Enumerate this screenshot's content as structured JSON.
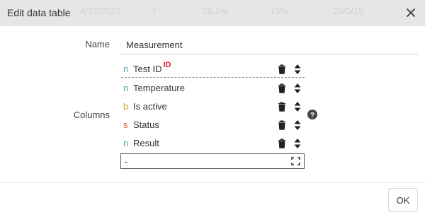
{
  "dialog": {
    "title": "Edit data table",
    "background_row": [
      "4/17/2022",
      "7",
      "16.1%",
      "15%",
      "20/0/15"
    ]
  },
  "form": {
    "name_label": "Name",
    "name_value": "Measurement",
    "columns_label": "Columns",
    "add_column_value": "-"
  },
  "columns": [
    {
      "type": "n",
      "type_color": "#5aa0a8",
      "name": "Test ID",
      "badge": "ID"
    },
    {
      "type": "n",
      "type_color": "#5aa0a8",
      "name": "Temperature"
    },
    {
      "type": "b",
      "type_color": "#c9a227",
      "name": "Is active"
    },
    {
      "type": "s",
      "type_color": "#d0622a",
      "name": "Status"
    },
    {
      "type": "n",
      "type_color": "#5aa0a8",
      "name": "Result"
    }
  ],
  "icons": {
    "close": "close-icon",
    "delete": "trash-icon",
    "sort": "sort-icon",
    "expand": "expand-icon",
    "help": "help-icon"
  },
  "footer": {
    "ok_label": "OK"
  },
  "colors": {
    "header_bg": "#e6e6e6",
    "id_badge": "#e0182d"
  }
}
